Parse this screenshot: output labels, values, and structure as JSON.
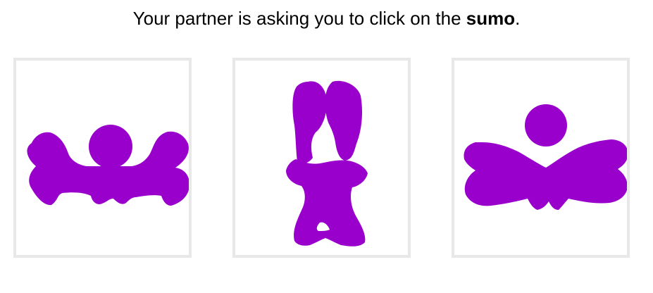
{
  "prompt": {
    "prefix": "Your partner is asking you to click on the ",
    "target_word": "sumo",
    "suffix": "."
  },
  "tangram_color": "#9900cc",
  "card_border_color": "#e8e8e8",
  "cards": [
    {
      "figure": "wide-figure-with-raised-arms"
    },
    {
      "figure": "tall-upside-down-figure"
    },
    {
      "figure": "figure-with-wings"
    }
  ]
}
